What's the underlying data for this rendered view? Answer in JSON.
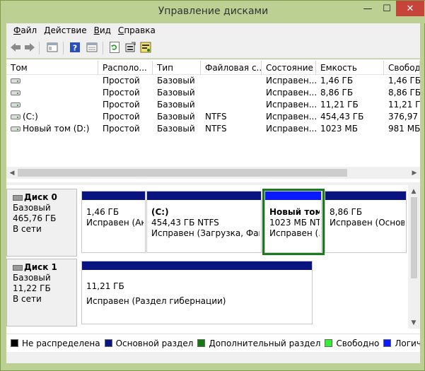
{
  "window": {
    "title": "Управление дисками",
    "min": "—",
    "max": "☐",
    "close": "✕"
  },
  "menu": [
    {
      "key": "Ф",
      "rest": "айл"
    },
    {
      "key": "Д",
      "rest": "ействие"
    },
    {
      "key": "В",
      "rest": "ид"
    },
    {
      "key": "С",
      "rest": "правка"
    }
  ],
  "columns": [
    "Том",
    "Располо...",
    "Тип",
    "Файловая с...",
    "Состояние",
    "Емкость",
    "Свобода"
  ],
  "volumes": [
    {
      "name": "",
      "layout": "Простой",
      "type": "Базовый",
      "fs": "",
      "status": "Исправен...",
      "capacity": "1,46 ГБ",
      "free": "1,46 ГБ"
    },
    {
      "name": "",
      "layout": "Простой",
      "type": "Базовый",
      "fs": "",
      "status": "Исправен...",
      "capacity": "8,86 ГБ",
      "free": "8,86 ГБ"
    },
    {
      "name": "",
      "layout": "Простой",
      "type": "Базовый",
      "fs": "",
      "status": "Исправен...",
      "capacity": "11,21 ГБ",
      "free": "11,21 ГБ"
    },
    {
      "name": "(C:)",
      "layout": "Простой",
      "type": "Базовый",
      "fs": "NTFS",
      "status": "Исправен...",
      "capacity": "454,43 ГБ",
      "free": "376,97 ГБ"
    },
    {
      "name": "Новый том (D:)",
      "layout": "Простой",
      "type": "Базовый",
      "fs": "NTFS",
      "status": "Исправен...",
      "capacity": "1023 МБ",
      "free": "981 МБ"
    }
  ],
  "disks": [
    {
      "name": "Диск 0",
      "type": "Базовый",
      "size": "465,76 ГБ",
      "state": "В сети",
      "partitions": [
        {
          "label": "",
          "line1": "1,46 ГБ",
          "line2": "Исправен (Ак"
        },
        {
          "label": "(C:)",
          "line1": "454,43 ГБ NTFS",
          "line2": "Исправен (Загрузка, Файл"
        },
        {
          "label": "Новый том",
          "line1": "1023 МБ NT",
          "line2": "Исправен (."
        },
        {
          "label": "",
          "line1": "8,86 ГБ",
          "line2": "Исправен (Основ"
        }
      ]
    },
    {
      "name": "Диск 1",
      "type": "Базовый",
      "size": "11,22 ГБ",
      "state": "В сети",
      "partitions": [
        {
          "label": "",
          "line1": "11,21 ГБ",
          "line2": "Исправен (Раздел гибернации)"
        }
      ]
    }
  ],
  "legend": [
    {
      "label": "Не распределена",
      "color": "#000000"
    },
    {
      "label": "Основной раздел",
      "color": "#0a1480"
    },
    {
      "label": "Дополнительный раздел",
      "color": "#127a12"
    },
    {
      "label": "Свободно",
      "color": "#33ee33"
    },
    {
      "label": "Логический диск",
      "color": "#0a1aff"
    }
  ]
}
